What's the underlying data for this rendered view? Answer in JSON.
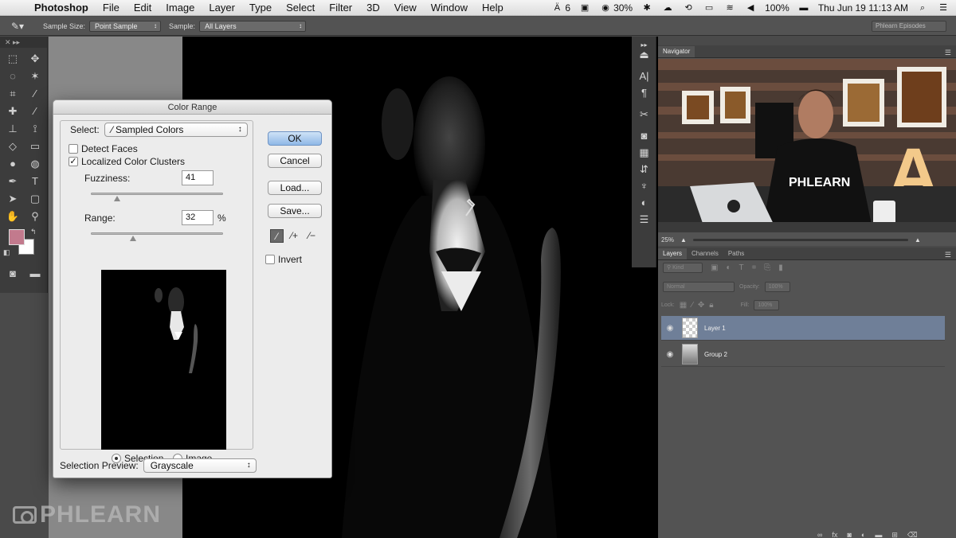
{
  "menubar": {
    "apple": "",
    "items": [
      "Photoshop",
      "File",
      "Edit",
      "Image",
      "Layer",
      "Type",
      "Select",
      "Filter",
      "3D",
      "View",
      "Window",
      "Help"
    ],
    "status": {
      "adobe_count": "6",
      "battery_pct": "30%",
      "battery_full": "100%",
      "clock": "Thu Jun 19  11:13 AM"
    }
  },
  "options_bar": {
    "sample_size_label": "Sample Size:",
    "sample_size_value": "Point Sample",
    "sample_label": "Sample:",
    "sample_value": "All Layers",
    "workspace": "Phlearn Episodes"
  },
  "colors": {
    "foreground": "#c27a8d",
    "background": "#ffffff",
    "selected_layer": "#6f7f98",
    "ok_button": "#8fb8e7"
  },
  "dialog": {
    "title": "Color Range",
    "select_label": "Select:",
    "select_value": "Sampled Colors",
    "detect_faces": {
      "label": "Detect Faces",
      "checked": false
    },
    "localized_clusters": {
      "label": "Localized Color Clusters",
      "checked": true,
      "mark": "✓"
    },
    "fuzziness": {
      "label": "Fuzziness:",
      "value": "41",
      "fraction": 0.2
    },
    "range": {
      "label": "Range:",
      "value": "32",
      "unit": "%",
      "fraction": 0.32
    },
    "radio_selection": "Selection",
    "radio_image": "Image",
    "selected_radio": "Selection",
    "preview_label": "Selection Preview:",
    "preview_value": "Grayscale",
    "buttons": {
      "ok": "OK",
      "cancel": "Cancel",
      "load": "Load...",
      "save": "Save..."
    },
    "invert": {
      "label": "Invert",
      "checked": false
    }
  },
  "navigator": {
    "tab": "Navigator",
    "zoom": "25%",
    "shirt_text": "PHLEARN",
    "sign_letter": "A"
  },
  "layers_panel": {
    "tabs": [
      "Layers",
      "Channels",
      "Paths"
    ],
    "filter_label": "Kind",
    "blend_mode": "Normal",
    "opacity_label": "Opacity:",
    "opacity_value": "100%",
    "lock_label": "Lock:",
    "fill_label": "Fill:",
    "fill_value": "100%",
    "layers": [
      {
        "name": "Layer 1",
        "selected": true,
        "thumb": "transparent"
      },
      {
        "name": "Group 2",
        "selected": false,
        "thumb": "photo"
      }
    ]
  },
  "watermark": "PHLEARN"
}
